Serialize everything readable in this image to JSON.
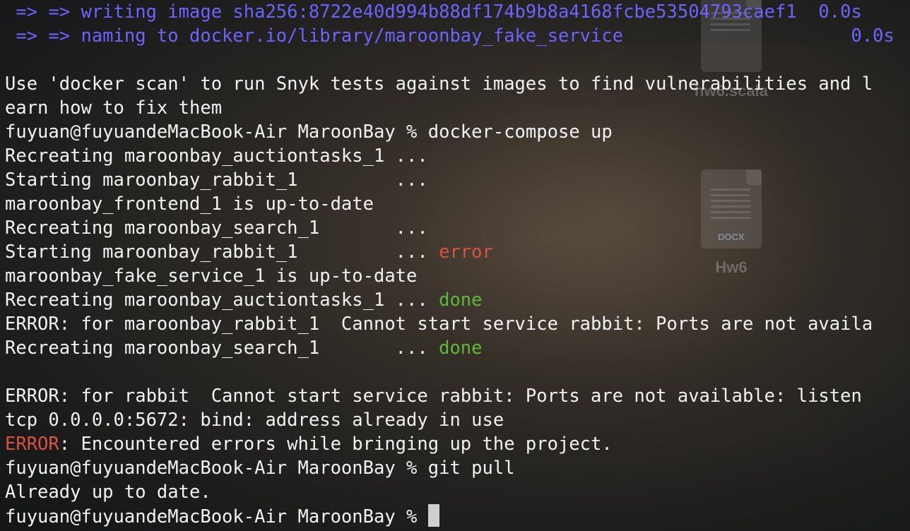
{
  "desktop": {
    "icons": [
      {
        "name": "hw6.scala"
      },
      {
        "name": "Hw6",
        "badge": "DOCX"
      }
    ]
  },
  "terminal": {
    "lines": [
      {
        "segments": [
          {
            "text": " => => writing image sha256:8722e40d994b88df174b9b8a4168fcbe53504793caef1  0.0s",
            "style": "blue"
          }
        ]
      },
      {
        "segments": [
          {
            "text": " => => naming to docker.io/library/maroonbay_fake_service                     0.0s",
            "style": "blue"
          }
        ]
      },
      {
        "segments": [
          {
            "text": "",
            "style": "plain"
          }
        ]
      },
      {
        "segments": [
          {
            "text": "Use 'docker scan' to run Snyk tests against images to find vulnerabilities and l",
            "style": "plain"
          }
        ]
      },
      {
        "segments": [
          {
            "text": "earn how to fix them",
            "style": "plain"
          }
        ]
      },
      {
        "segments": [
          {
            "text": "fuyuan@fuyuandeMacBook-Air MaroonBay % docker-compose up",
            "style": "plain"
          }
        ]
      },
      {
        "segments": [
          {
            "text": "Recreating maroonbay_auctiontasks_1 ...",
            "style": "plain"
          }
        ]
      },
      {
        "segments": [
          {
            "text": "Starting maroonbay_rabbit_1         ...",
            "style": "plain"
          }
        ]
      },
      {
        "segments": [
          {
            "text": "maroonbay_frontend_1 is up-to-date",
            "style": "plain"
          }
        ]
      },
      {
        "segments": [
          {
            "text": "Recreating maroonbay_search_1       ...",
            "style": "plain"
          }
        ]
      },
      {
        "segments": [
          {
            "text": "Starting maroonbay_rabbit_1         ... ",
            "style": "plain"
          },
          {
            "text": "error",
            "style": "red"
          }
        ]
      },
      {
        "segments": [
          {
            "text": "maroonbay_fake_service_1 is up-to-date",
            "style": "plain"
          }
        ]
      },
      {
        "segments": [
          {
            "text": "Recreating maroonbay_auctiontasks_1 ... ",
            "style": "plain"
          },
          {
            "text": "done",
            "style": "green"
          }
        ]
      },
      {
        "segments": [
          {
            "text": "ERROR: for maroonbay_rabbit_1  Cannot start service rabbit: Ports are not availa",
            "style": "plain"
          }
        ]
      },
      {
        "segments": [
          {
            "text": "Recreating maroonbay_search_1       ... ",
            "style": "plain"
          },
          {
            "text": "done",
            "style": "green"
          }
        ]
      },
      {
        "segments": [
          {
            "text": "",
            "style": "plain"
          }
        ]
      },
      {
        "segments": [
          {
            "text": "ERROR: for rabbit  Cannot start service rabbit: Ports are not available: listen",
            "style": "plain"
          }
        ]
      },
      {
        "segments": [
          {
            "text": "tcp 0.0.0.0:5672: bind: address already in use",
            "style": "plain"
          }
        ]
      },
      {
        "segments": [
          {
            "text": "ERROR",
            "style": "red"
          },
          {
            "text": ": Encountered errors while bringing up the project.",
            "style": "plain"
          }
        ]
      },
      {
        "segments": [
          {
            "text": "fuyuan@fuyuandeMacBook-Air MaroonBay % git pull",
            "style": "plain"
          }
        ]
      },
      {
        "segments": [
          {
            "text": "Already up to date.",
            "style": "plain"
          }
        ]
      },
      {
        "segments": [
          {
            "text": "fuyuan@fuyuandeMacBook-Air MaroonBay % ",
            "style": "plain"
          }
        ],
        "cursor": true
      }
    ]
  }
}
